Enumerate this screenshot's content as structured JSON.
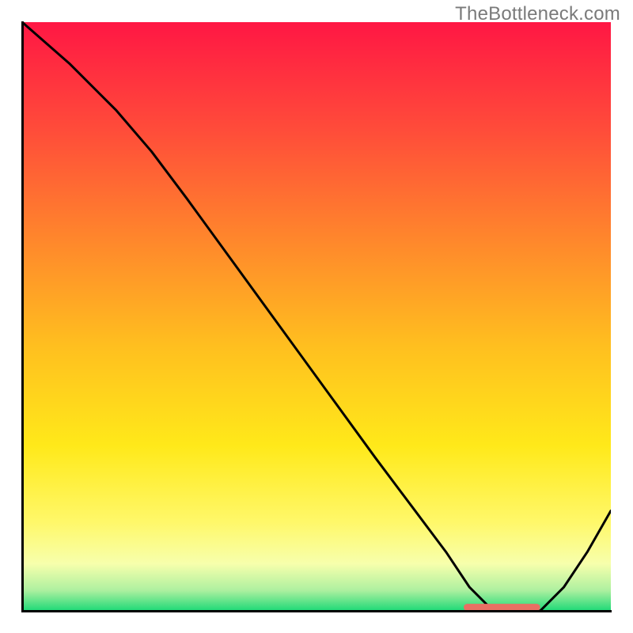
{
  "watermark": "TheBottleneck.com",
  "colors": {
    "gradient_stops": [
      {
        "offset": 0.0,
        "hex": "#ff1744"
      },
      {
        "offset": 0.18,
        "hex": "#ff4b3a"
      },
      {
        "offset": 0.38,
        "hex": "#ff8a2b"
      },
      {
        "offset": 0.55,
        "hex": "#ffbf1f"
      },
      {
        "offset": 0.72,
        "hex": "#ffe91a"
      },
      {
        "offset": 0.85,
        "hex": "#fff86a"
      },
      {
        "offset": 0.92,
        "hex": "#f7ffac"
      },
      {
        "offset": 0.965,
        "hex": "#aef0a0"
      },
      {
        "offset": 1.0,
        "hex": "#1ed977"
      }
    ],
    "curve": "#000000",
    "marker": "#e86f63",
    "axis": "#000000"
  },
  "chart_data": {
    "type": "line",
    "title": "",
    "xlabel": "",
    "ylabel": "",
    "xlim": [
      0,
      100
    ],
    "ylim": [
      0,
      100
    ],
    "grid": false,
    "legend": false,
    "series": [
      {
        "name": "curve",
        "x": [
          0,
          8,
          16,
          22,
          28,
          36,
          44,
          52,
          60,
          66,
          72,
          76,
          80,
          84,
          88,
          92,
          96,
          100
        ],
        "y": [
          100,
          93,
          85,
          78,
          70,
          59,
          48,
          37,
          26,
          18,
          10,
          4,
          0,
          0,
          0,
          4,
          10,
          17
        ]
      }
    ],
    "marker_band": {
      "x_start": 75,
      "x_end": 88,
      "y": 0.6,
      "thickness": 1.2
    }
  }
}
